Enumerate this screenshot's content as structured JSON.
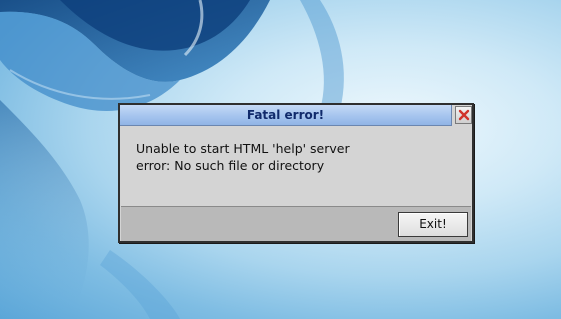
{
  "dialog": {
    "title": "Fatal error!",
    "message_lines": [
      "Unable to start HTML 'help' server",
      "error: No such file or directory"
    ],
    "exit_label": "Exit!",
    "close_icon": "close-icon"
  },
  "colors": {
    "titlebar": "#a8c6ef",
    "title_text": "#102a6b",
    "close_x": "#d0342c",
    "dialog_bg": "#d4d4d4",
    "button_area_bg": "#b9b9b9",
    "desktop": "#7fbde3"
  }
}
